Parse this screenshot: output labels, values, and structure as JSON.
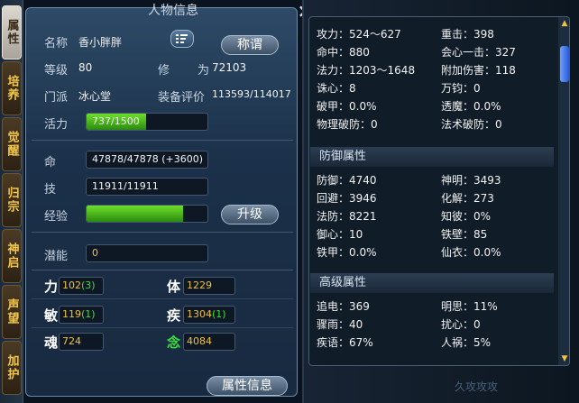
{
  "window": {
    "title": "人物信息",
    "close_icon": "×"
  },
  "tabs": [
    {
      "label": "属性",
      "active": true
    },
    {
      "label": "培养",
      "active": false
    },
    {
      "label": "觉醒",
      "active": false
    },
    {
      "label": "归宗",
      "active": false
    },
    {
      "label": "神启",
      "active": false
    },
    {
      "label": "声望",
      "active": false
    },
    {
      "label": "加护",
      "active": false
    }
  ],
  "profile": {
    "name_label": "名称",
    "name": "香小胖胖",
    "title_button": "称谓",
    "level_label": "等级",
    "level": "80",
    "cultivation_label": "修",
    "cultivation_label2": "为",
    "cultivation": "72103",
    "sect_label": "门派",
    "sect": "冰心堂",
    "rating_label": "装备评价",
    "rating": "113593/114017",
    "vitality_label": "活力",
    "vitality": "737/1500",
    "vitality_pct": 49
  },
  "vitals": {
    "hp_label": "命",
    "hp": "47878/47878 (+3600)",
    "skill_label": "技",
    "skill": "11911/11911",
    "exp_label": "经验",
    "exp_pct": 80,
    "upgrade_button": "升级",
    "potential_label": "潜能",
    "potential": "0"
  },
  "attributes": [
    {
      "name": "力",
      "value": "102",
      "bonus": "(3)"
    },
    {
      "name": "体",
      "value": "1229",
      "bonus": ""
    },
    {
      "name": "敏",
      "value": "119",
      "bonus": "(1)"
    },
    {
      "name": "疾",
      "value": "1304",
      "bonus": "(1)"
    },
    {
      "name": "魂",
      "value": "724",
      "bonus": ""
    },
    {
      "name": "念",
      "value": "4084",
      "bonus": ""
    }
  ],
  "attr_info_button": "属性信息",
  "attack": [
    [
      "攻力：524～627",
      "重击：398"
    ],
    [
      "命中：880",
      "会心一击：327"
    ],
    [
      "法力：1203～1648",
      "附加伤害：118"
    ],
    [
      "诛心：8",
      "万钧：0"
    ],
    [
      "破甲：0.0%",
      "透魔：0.0%"
    ],
    [
      "物理破防：0",
      "法术破防：0"
    ]
  ],
  "defense_title": "防御属性",
  "defense": [
    [
      "防御：4740",
      "神明：3493"
    ],
    [
      "回避：3946",
      "化解：273"
    ],
    [
      "法防：8221",
      "知彼：0%"
    ],
    [
      "御心：10",
      "铁壁：85"
    ],
    [
      "铁甲：0.0%",
      "仙衣：0.0%"
    ]
  ],
  "advanced_title": "高级属性",
  "advanced": [
    [
      "追电：369",
      "明思：11%"
    ],
    [
      "骤雨：40",
      "扰心：0"
    ],
    [
      "疾语：67%",
      "人祸：5%"
    ]
  ],
  "watermark": "久攻攻攻"
}
